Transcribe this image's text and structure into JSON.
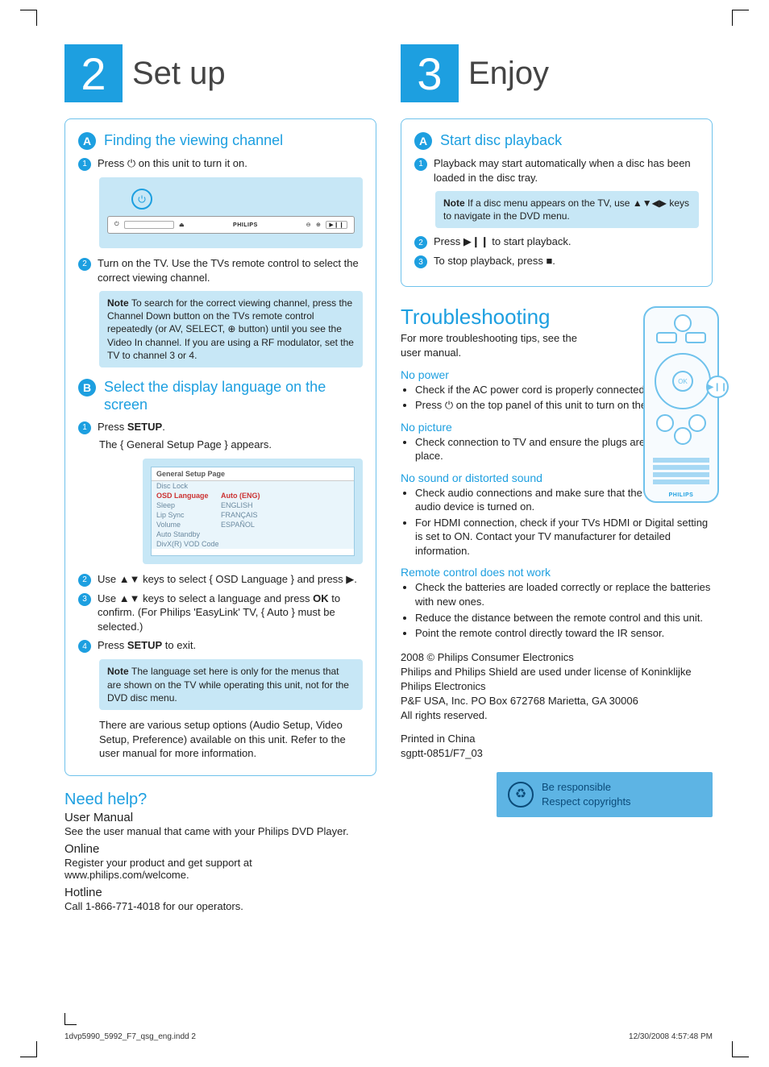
{
  "section2": {
    "number": "2",
    "title": "Set up",
    "A": {
      "letter": "A",
      "title": "Finding the viewing channel",
      "step1": "Press ⏻ on this unit to turn it on.",
      "step2": "Turn on the TV. Use the TVs remote control to select the correct viewing channel.",
      "note_label": "Note",
      "note": "To search for the correct viewing channel, press the Channel Down button on the TVs remote control repeatedly (or AV, SELECT, ⊕ button) until you see the Video In channel. If you are using a RF modulator, set the TV to channel 3 or 4."
    },
    "B": {
      "letter": "B",
      "title": "Select the display language on the screen",
      "step1_pre": "Press ",
      "step1_bold": "SETUP",
      "step1_post": ".",
      "step1_sub": "The { General Setup Page } appears.",
      "menu": {
        "title": "General Setup Page",
        "rows": [
          {
            "l": "Disc Lock",
            "r": ""
          },
          {
            "l": "OSD Language",
            "r": "Auto (ENG)",
            "sel": true
          },
          {
            "l": "Sleep",
            "r": "ENGLISH"
          },
          {
            "l": "Lip Sync",
            "r": "FRANÇAIS"
          },
          {
            "l": "Volume",
            "r": "ESPAÑOL"
          },
          {
            "l": "Auto Standby",
            "r": ""
          },
          {
            "l": "DivX(R) VOD Code",
            "r": ""
          }
        ]
      },
      "step2": "Use ▲▼ keys to select { OSD Language } and press ▶.",
      "step3_pre": "Use ▲▼ keys to select a language and press ",
      "step3_bold": "OK",
      "step3_post": " to confirm. (For Philips 'EasyLink' TV, { Auto } must be selected.)",
      "step4_pre": "Press ",
      "step4_bold": "SETUP",
      "step4_post": " to exit.",
      "note_label": "Note",
      "note": "The language set here is only for the menus that are shown on the TV while operating this unit, not for the DVD disc menu.",
      "para": "There are various setup options (Audio Setup, Video Setup, Preference) available on this unit. Refer to the user manual for more information."
    }
  },
  "section3": {
    "number": "3",
    "title": "Enjoy",
    "A": {
      "letter": "A",
      "title": "Start disc playback",
      "step1": "Playback may start automatically when a disc has been loaded in the disc tray.",
      "note_label": "Note",
      "note": "If a disc menu appears on the TV, use ▲▼◀▶ keys to navigate in the DVD menu.",
      "step2": "Press ▶❙❙ to start playback.",
      "step3": "To stop playback, press ■."
    }
  },
  "troubleshooting": {
    "title": "Troubleshooting",
    "sub": "For more troubleshooting tips, see the user manual.",
    "groups": [
      {
        "label": "No power",
        "items": [
          "Check if the AC power cord is properly connected.",
          "Press ⏻ on the top panel of this unit to turn on the power."
        ]
      },
      {
        "label": "No picture",
        "items": [
          "Check connection to TV and ensure the plugs are firmly in place."
        ]
      },
      {
        "label": "No sound or distorted sound",
        "items": [
          "Check audio connections and make sure that the connected audio device is turned on.",
          "For HDMI connection, check if your TVs HDMI or Digital setting is set to ON. Contact your TV manufacturer for detailed information."
        ]
      },
      {
        "label": "Remote control does not work",
        "items": [
          "Check the batteries are loaded correctly or replace the batteries with new ones.",
          "Reduce the distance between the remote control and this unit.",
          "Point the remote control directly toward the IR sensor."
        ]
      }
    ]
  },
  "remote": {
    "ok": "OK",
    "logo": "PHILIPS"
  },
  "device": {
    "brand": "PHILIPS"
  },
  "help": {
    "title": "Need help?",
    "user_manual_h": "User Manual",
    "user_manual": "See the user manual that came with your Philips DVD Player.",
    "online_h": "Online",
    "online": "Register your product and get support at www.philips.com/welcome.",
    "hotline_h": "Hotline",
    "hotline": "Call 1-866-771-4018 for our operators."
  },
  "legal": {
    "l1": "2008 © Philips Consumer Electronics",
    "l2": "Philips and Philips Shield are used under license of Koninklijke Philips Electronics",
    "l3": "P&F USA, Inc. PO Box 672768 Marietta, GA 30006",
    "l4": "All rights reserved.",
    "l5": "Printed in China",
    "l6": "sgptt-0851/F7_03"
  },
  "responsible": {
    "line1": "Be responsible",
    "line2": "Respect copyrights"
  },
  "footer": {
    "left": "1dvp5990_5992_F7_qsg_eng.indd   2",
    "right": "12/30/2008   4:57:48 PM"
  }
}
